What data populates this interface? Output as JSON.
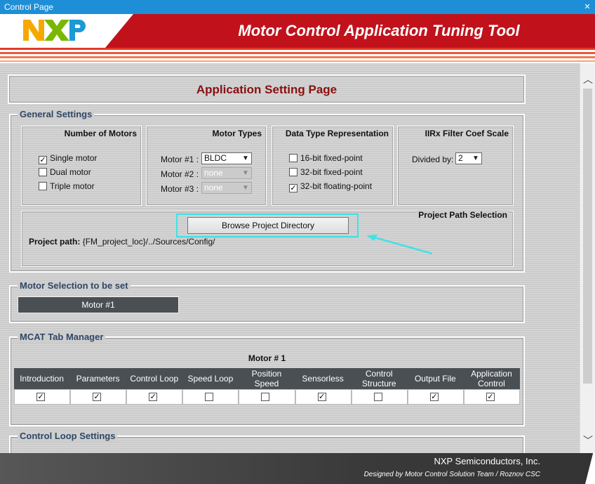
{
  "window": {
    "title": "Control Page",
    "close_glyph": "✕"
  },
  "banner": {
    "app_title": "Motor Control Application Tuning Tool",
    "logo_text": "NXP"
  },
  "page": {
    "header": "Application Setting Page"
  },
  "general": {
    "legend": "General Settings",
    "motors": {
      "title": "Number of Motors",
      "options": [
        {
          "label": "Single motor",
          "checked": true
        },
        {
          "label": "Dual motor",
          "checked": false
        },
        {
          "label": "Triple motor",
          "checked": false
        }
      ]
    },
    "motor_types": {
      "title": "Motor Types",
      "rows": [
        {
          "label": "Motor #1 :",
          "value": "BLDC",
          "disabled": false
        },
        {
          "label": "Motor #2 :",
          "value": "none",
          "disabled": true
        },
        {
          "label": "Motor #3 :",
          "value": "none",
          "disabled": true
        }
      ]
    },
    "data_type": {
      "title": "Data Type Representation",
      "options": [
        {
          "label": "16-bit fixed-point",
          "checked": false
        },
        {
          "label": "32-bit fixed-point",
          "checked": false
        },
        {
          "label": "32-bit floating-point",
          "checked": true
        }
      ]
    },
    "filter": {
      "title": "IIRx Filter Coef Scale",
      "label": "Divided by:",
      "value": "2"
    },
    "path": {
      "title": "Project Path Selection",
      "browse_label": "Browse Project Directory",
      "path_label": "Project path:",
      "path_value": "{FM_project_loc}/../Sources/Config/"
    }
  },
  "motor_selection": {
    "legend": "Motor Selection to be set",
    "button": "Motor #1"
  },
  "tab_manager": {
    "legend": "MCAT Tab Manager",
    "motor_title": "Motor # 1",
    "columns": [
      {
        "label": "Introduction",
        "checked": true
      },
      {
        "label": "Parameters",
        "checked": true
      },
      {
        "label": "Control Loop",
        "checked": true
      },
      {
        "label": "Speed Loop",
        "checked": false
      },
      {
        "label": "Position Speed",
        "checked": false
      },
      {
        "label": "Sensorless",
        "checked": true
      },
      {
        "label": "Control Structure",
        "checked": false
      },
      {
        "label": "Output File",
        "checked": true
      },
      {
        "label": "Application Control",
        "checked": true
      }
    ]
  },
  "control_loop": {
    "legend": "Control Loop Settings"
  },
  "footer": {
    "company": "NXP Semiconductors, Inc.",
    "designed": "Designed by Motor Control Solution Team / Roznov CSC"
  },
  "colors": {
    "accent_red": "#c1121c",
    "title_blue": "#2f4766",
    "highlight": "#3ee3e6",
    "header_red": "#8b0e0e"
  }
}
